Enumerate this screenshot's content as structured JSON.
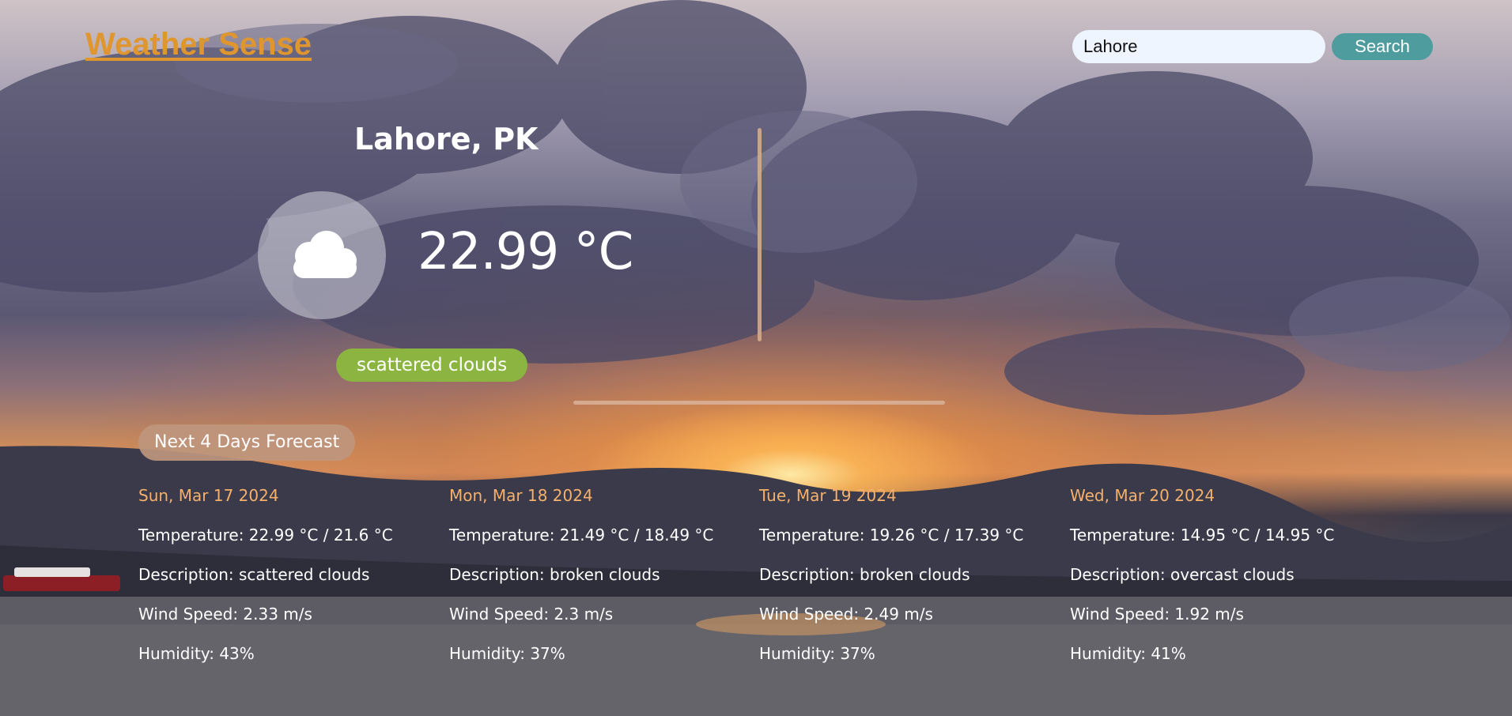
{
  "app": {
    "title": "Weather Sense"
  },
  "search": {
    "value": "Lahore",
    "button_label": "Search"
  },
  "current": {
    "location": "Lahore, PK",
    "temperature": "22.99 °C",
    "description": "scattered clouds",
    "icon": "cloud-icon"
  },
  "forecast": {
    "title": "Next 4 Days Forecast",
    "days": [
      {
        "date": "Sun, Mar 17 2024",
        "temperature": "Temperature: 22.99 °C / 21.6 °C",
        "description": "Description: scattered clouds",
        "wind": "Wind Speed: 2.33 m/s",
        "humidity": "Humidity: 43%"
      },
      {
        "date": "Mon, Mar 18 2024",
        "temperature": "Temperature: 21.49 °C / 18.49 °C",
        "description": "Description: broken clouds",
        "wind": "Wind Speed: 2.3 m/s",
        "humidity": "Humidity: 37%"
      },
      {
        "date": "Tue, Mar 19 2024",
        "temperature": "Temperature: 19.26 °C / 17.39 °C",
        "description": "Description: broken clouds",
        "wind": "Wind Speed: 2.49 m/s",
        "humidity": "Humidity: 37%"
      },
      {
        "date": "Wed, Mar 20 2024",
        "temperature": "Temperature: 14.95 °C / 14.95 °C",
        "description": "Description: overcast clouds",
        "wind": "Wind Speed: 1.92 m/s",
        "humidity": "Humidity: 41%"
      }
    ]
  },
  "colors": {
    "logo": "#e0962f",
    "search_button": "#4f9c9e",
    "description_badge": "#8bb540",
    "forecast_badge": "#be967d",
    "forecast_date": "#f5b06b"
  }
}
